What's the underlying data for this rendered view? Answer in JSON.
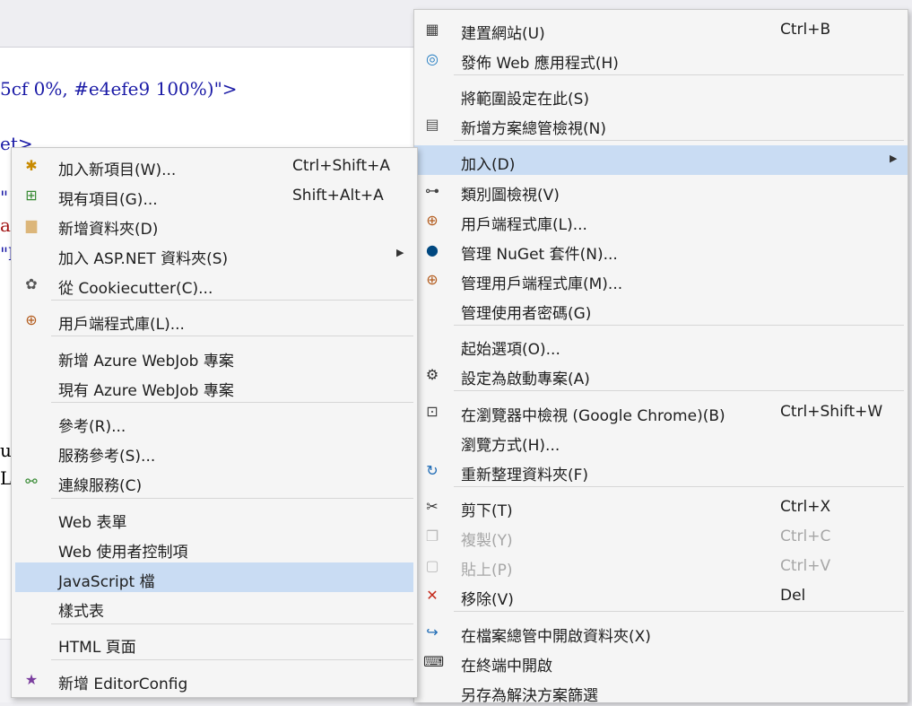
{
  "editor": {
    "lines": [
      {
        "text": "5cf 0%, #e4efe9 100%)\">",
        "color": "#1a1aa6"
      },
      {
        "text": "et>",
        "color": "#1a1aa6"
      },
      {
        "text": "\"",
        "color": "#1a1aa6"
      },
      {
        "text": "ar",
        "color": "#a31515"
      },
      {
        "text": "\"b",
        "color": "#1a1aa6"
      },
      {
        "text": "uc",
        "color": "#000000"
      },
      {
        "text": "L",
        "color": "#000000"
      }
    ]
  },
  "main_menu": {
    "items": [
      {
        "label": "建置網站(U)",
        "shortcut": "Ctrl+B",
        "icon": "build-icon"
      },
      {
        "label": "發佈 Web 應用程式(H)",
        "shortcut": "",
        "icon": "globe-publish-icon"
      },
      {
        "label": "將範圍設定在此(S)",
        "shortcut": "",
        "icon": ""
      },
      {
        "label": "新增方案總管檢視(N)",
        "shortcut": "",
        "icon": "new-view-icon"
      },
      {
        "label": "加入(D)",
        "shortcut": "",
        "icon": ""
      },
      {
        "label": "類別圖檢視(V)",
        "shortcut": "",
        "icon": "class-diagram-icon"
      },
      {
        "label": "用戶端程式庫(L)...",
        "shortcut": "",
        "icon": "client-library-icon"
      },
      {
        "label": "管理 NuGet 套件(N)...",
        "shortcut": "",
        "icon": "nuget-icon"
      },
      {
        "label": "管理用戶端程式庫(M)...",
        "shortcut": "",
        "icon": "client-library-icon"
      },
      {
        "label": "管理使用者密碼(G)",
        "shortcut": "",
        "icon": ""
      },
      {
        "label": "起始選項(O)...",
        "shortcut": "",
        "icon": ""
      },
      {
        "label": "設定為啟動專案(A)",
        "shortcut": "",
        "icon": "gear-icon"
      },
      {
        "label": "在瀏覽器中檢視 (Google Chrome)(B)",
        "shortcut": "Ctrl+Shift+W",
        "icon": "browser-view-icon"
      },
      {
        "label": "瀏覽方式(H)...",
        "shortcut": "",
        "icon": ""
      },
      {
        "label": "重新整理資料夾(F)",
        "shortcut": "",
        "icon": "refresh-icon"
      },
      {
        "label": "剪下(T)",
        "shortcut": "Ctrl+X",
        "icon": "scissors-icon"
      },
      {
        "label": "複製(Y)",
        "shortcut": "Ctrl+C",
        "icon": "copy-icon"
      },
      {
        "label": "貼上(P)",
        "shortcut": "Ctrl+V",
        "icon": "paste-icon"
      },
      {
        "label": "移除(V)",
        "shortcut": "Del",
        "icon": "remove-x-icon"
      },
      {
        "label": "在檔案總管中開啟資料夾(X)",
        "shortcut": "",
        "icon": "open-folder-arrow-icon"
      },
      {
        "label": "在終端中開啟",
        "shortcut": "",
        "icon": "terminal-icon"
      },
      {
        "label": "另存為解決方案篩選",
        "shortcut": "",
        "icon": ""
      }
    ]
  },
  "sub_menu": {
    "items": [
      {
        "label": "加入新項目(W)...",
        "shortcut": "Ctrl+Shift+A",
        "icon": "new-item-icon"
      },
      {
        "label": "現有項目(G)...",
        "shortcut": "Shift+Alt+A",
        "icon": "existing-item-icon"
      },
      {
        "label": "新增資料夾(D)",
        "shortcut": "",
        "icon": "new-folder-icon"
      },
      {
        "label": "加入 ASP.NET 資料夾(S)",
        "shortcut": "",
        "icon": ""
      },
      {
        "label": "從 Cookiecutter(C)...",
        "shortcut": "",
        "icon": "cookiecutter-icon"
      },
      {
        "label": "用戶端程式庫(L)...",
        "shortcut": "",
        "icon": "client-library-icon"
      },
      {
        "label": "新增 Azure WebJob 專案",
        "shortcut": "",
        "icon": ""
      },
      {
        "label": "現有 Azure WebJob 專案",
        "shortcut": "",
        "icon": ""
      },
      {
        "label": "參考(R)...",
        "shortcut": "",
        "icon": ""
      },
      {
        "label": "服務參考(S)...",
        "shortcut": "",
        "icon": ""
      },
      {
        "label": "連線服務(C)",
        "shortcut": "",
        "icon": "connected-service-icon"
      },
      {
        "label": "Web 表單",
        "shortcut": "",
        "icon": ""
      },
      {
        "label": "Web 使用者控制項",
        "shortcut": "",
        "icon": ""
      },
      {
        "label": "JavaScript 檔",
        "shortcut": "",
        "icon": ""
      },
      {
        "label": "樣式表",
        "shortcut": "",
        "icon": ""
      },
      {
        "label": "HTML 頁面",
        "shortcut": "",
        "icon": ""
      },
      {
        "label": "新增 EditorConfig",
        "shortcut": "",
        "icon": "editorconfig-icon"
      }
    ]
  }
}
